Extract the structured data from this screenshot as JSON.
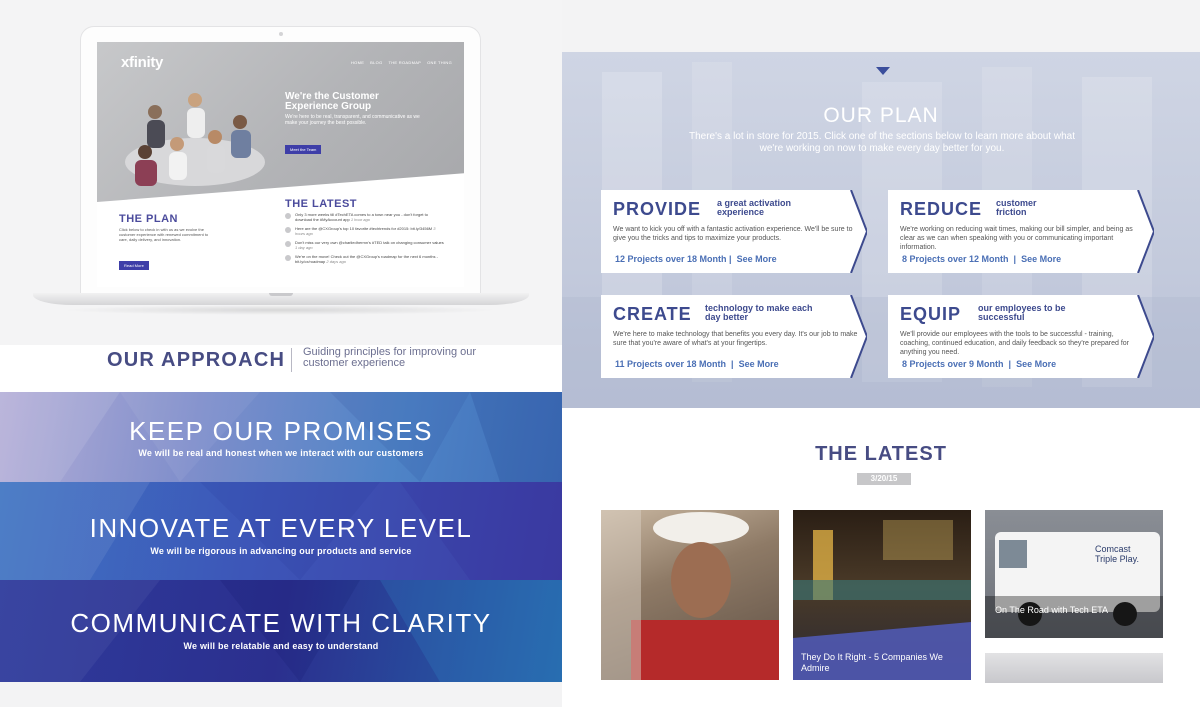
{
  "mockup": {
    "logo": "xfinity",
    "nav": [
      "HOME",
      "BLOG",
      "THE ROADMAP",
      "ONE THING"
    ],
    "hero_title": "We're the Customer Experience Group",
    "hero_text": "We're here to be real, transparent, and communicative as we make your journey the best possible.",
    "hero_button": "Meet the Team",
    "plan_title": "THE PLAN",
    "plan_text": "Click below to check in with us as we evolve the customer experience with renewed commitment to care, daily delivery, and innovation.",
    "plan_button": "Read More",
    "latest_title": "THE LATEST",
    "latest_items": [
      {
        "text": "Only 3 more weeks till #TechETA comes to a town near you - don't forget to download the #MyAccount app",
        "time": "1 hour ago"
      },
      {
        "text": "Here are the @CXGroup's top 10 favorite #techtrends for #2015: bit.ly/3456M",
        "time": "3 hours ago"
      },
      {
        "text": "Don't miss our very own @charliedhermn's #TED talk on changing consumer values",
        "time": "1 day ago"
      },
      {
        "text": "We're on the move! Check out the @CXGroup's roadmap for the next 6 months - bit.ly/cx/roadmap",
        "time": "2 days ago"
      }
    ]
  },
  "approach": {
    "title": "OUR APPROACH",
    "subtitle": "Guiding principles for improving our customer experience"
  },
  "principles": [
    {
      "title": "KEEP OUR PROMISES",
      "subtitle": "We will be real and honest when we interact with our customers"
    },
    {
      "title": "INNOVATE AT EVERY LEVEL",
      "subtitle": "We will be rigorous in advancing our products and service"
    },
    {
      "title": "COMMUNICATE WITH CLARITY",
      "subtitle": "We will be relatable and easy to understand"
    }
  ],
  "plan": {
    "title": "OUR PLAN",
    "intro": "There's a lot in store for 2015. Click one of the sections below to learn more about what we're working on now to make every day better for you.",
    "cards": [
      {
        "big": "PROVIDE",
        "small": "a great activation experience",
        "text": "We want to kick you off with a fantastic activation experience. We'll be sure to give you the tricks and tips to maximize your products.",
        "projects": "12 Projects over 18 Month",
        "see_more": "See More"
      },
      {
        "big": "REDUCE",
        "small": "customer friction",
        "text": "We're working on reducing wait times, making our bill simpler, and being as clear as we can when speaking with you or communicating important information.",
        "projects": "8 Projects over 12 Month",
        "see_more": "See More"
      },
      {
        "big": "CREATE",
        "small": "technology to make each day better",
        "text": "We're here to make technology that benefits you every day. It's our job to make sure that you're aware of what's at your fingertips.",
        "projects": "11 Projects over 18 Month",
        "see_more": "See More"
      },
      {
        "big": "EQUIP",
        "small": "our employees to be successful",
        "text": "We'll provide our employees with the tools to be successful - training, coaching, continued education, and daily feedback so they're prepared for anything you need.",
        "projects": "8 Projects over 9 Month",
        "see_more": "See More"
      }
    ]
  },
  "latest": {
    "title": "THE LATEST",
    "date": "3/20/15",
    "tiles": [
      {
        "caption": ""
      },
      {
        "caption": "They Do It Right - 5 Companies We Admire"
      },
      {
        "caption": "On The Road with Tech ETA",
        "van_text": "Comcast Triple Play."
      }
    ]
  },
  "colors": {
    "brand_navy": "#474c83",
    "accent_blue": "#4a6fb5",
    "button_blue": "#3e3ea8"
  }
}
